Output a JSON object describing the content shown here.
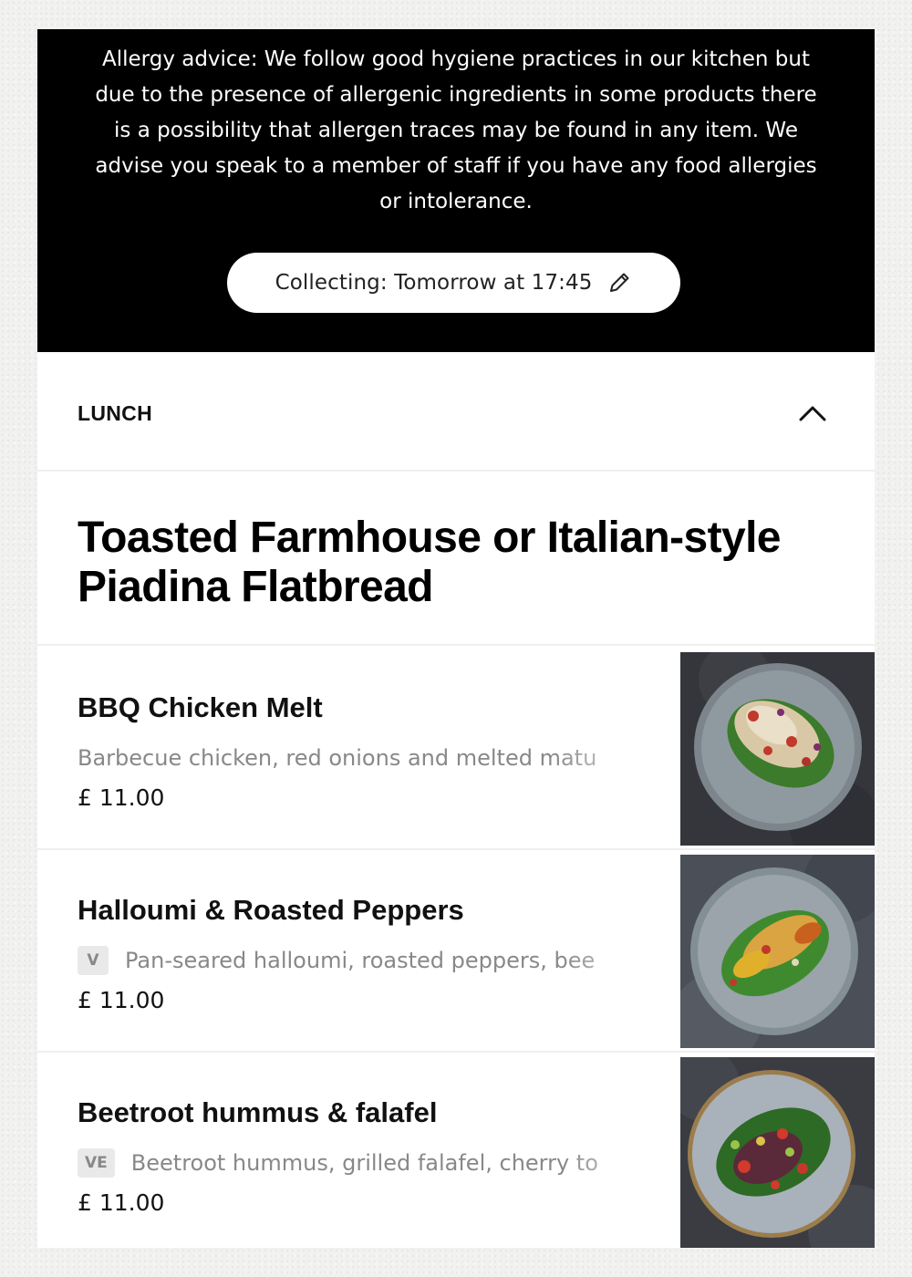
{
  "allergy": {
    "text": "Allergy advice: We follow good hygiene practices in our kitchen but due to the presence of allergenic ingredients in some products there is a possibility that allergen traces may be found in any item. We advise you speak to a member of staff if you have any food allergies or intolerance.",
    "collect_label": "Collecting: Tomorrow at 17:45",
    "collect_icon": "pencil-icon"
  },
  "section": {
    "title": "LUNCH",
    "toggle_icon": "chevron-up-icon"
  },
  "category": {
    "title": "Toasted Farmhouse or Italian-style Piadina Flatbread"
  },
  "items": [
    {
      "name": "BBQ Chicken Melt",
      "badge": "",
      "description": "Barbecue chicken, red onions and melted matu",
      "price": "£ 11.00",
      "plate_color": "#8f9aa0"
    },
    {
      "name": "Halloumi & Roasted Peppers",
      "badge": "V",
      "description": "Pan-seared halloumi, roasted peppers, bee",
      "price": "£ 11.00",
      "plate_color": "#9aa4aa"
    },
    {
      "name": "Beetroot hummus & falafel",
      "badge": "VE",
      "description": "Beetroot hummus, grilled falafel, cherry to",
      "price": "£ 11.00",
      "plate_color": "#a9b2ba"
    }
  ],
  "colors": {
    "banner_bg": "#000000",
    "text_primary": "#111111",
    "text_muted": "#888888",
    "badge_bg": "#e9e9e9"
  }
}
